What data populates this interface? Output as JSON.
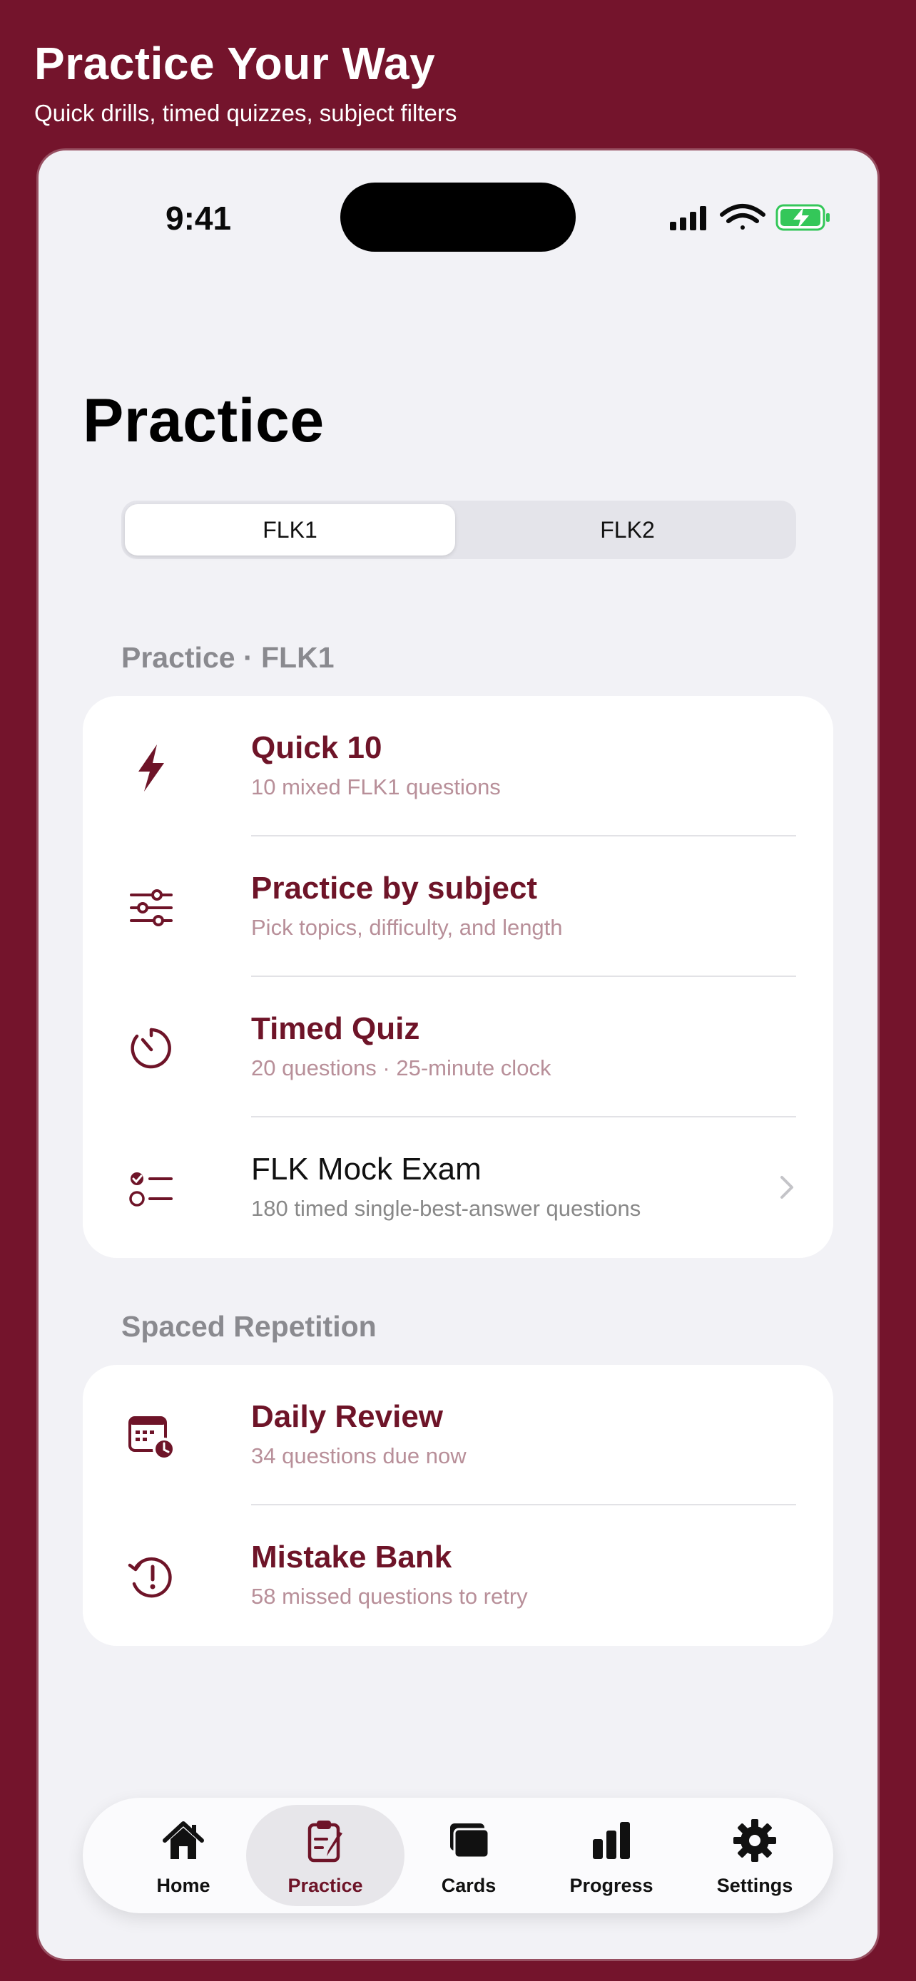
{
  "banner": {
    "title": "Practice Your Way",
    "subtitle": "Quick drills, timed quizzes, subject filters"
  },
  "status_bar": {
    "time": "9:41",
    "icons": [
      "cellular-signal-icon",
      "wifi-icon",
      "battery-charging-icon"
    ]
  },
  "page": {
    "title": "Practice"
  },
  "segments": {
    "options": [
      "FLK1",
      "FLK2"
    ],
    "selected": "FLK1"
  },
  "sections": {
    "practice": {
      "header": "Practice · FLK1",
      "items": [
        {
          "title": "Quick 10",
          "subtitle": "10 mixed FLK1 questions",
          "icon": "bolt-icon"
        },
        {
          "title": "Practice by subject",
          "subtitle": "Pick topics, difficulty, and length",
          "icon": "sliders-icon"
        },
        {
          "title": "Timed Quiz",
          "subtitle": "20 questions · 25-minute clock",
          "icon": "timer-icon"
        },
        {
          "title": "FLK Mock Exam",
          "subtitle": "180 timed single-best-answer questions",
          "icon": "checklist-icon"
        }
      ]
    },
    "spaced": {
      "header": "Spaced Repetition",
      "items": [
        {
          "title": "Daily Review",
          "subtitle": "34 questions due now",
          "icon": "calendar-clock-icon"
        },
        {
          "title": "Mistake Bank",
          "subtitle": "58 missed questions to retry",
          "icon": "history-alert-icon"
        }
      ]
    }
  },
  "tabbar": {
    "tabs": [
      {
        "label": "Home",
        "icon": "house-icon"
      },
      {
        "label": "Practice",
        "icon": "clipboard-pencil-icon"
      },
      {
        "label": "Cards",
        "icon": "cards-icon"
      },
      {
        "label": "Progress",
        "icon": "bar-chart-icon"
      },
      {
        "label": "Settings",
        "icon": "gear-icon"
      }
    ],
    "selected": "Practice"
  },
  "colors": {
    "brand": "#74142c",
    "accent": "#6e1428",
    "subtitle_muted": "#b88f99",
    "background": "#f2f2f6",
    "battery_green": "#34c759"
  }
}
